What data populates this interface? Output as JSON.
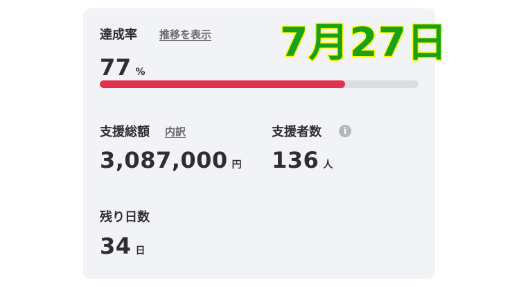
{
  "achievement": {
    "label": "達成率",
    "trend_link": "推移を表示",
    "value": "77",
    "unit": "%",
    "progress": 0.77,
    "progress_color": "#e2304d",
    "track_color": "#dcdde1"
  },
  "total_support": {
    "label": "支援総額",
    "breakdown_link": "内訳",
    "value": "3,087,000",
    "unit": "円"
  },
  "supporters": {
    "label": "支援者数",
    "info_icon": "info-icon",
    "info_glyph": "i",
    "value": "136",
    "unit": "人"
  },
  "remaining": {
    "label": "残り日数",
    "value": "34",
    "unit": "日"
  },
  "overlay": {
    "date_text": "7月27日",
    "text_color": "#1aa01a",
    "outline_color": "#ffff00"
  }
}
